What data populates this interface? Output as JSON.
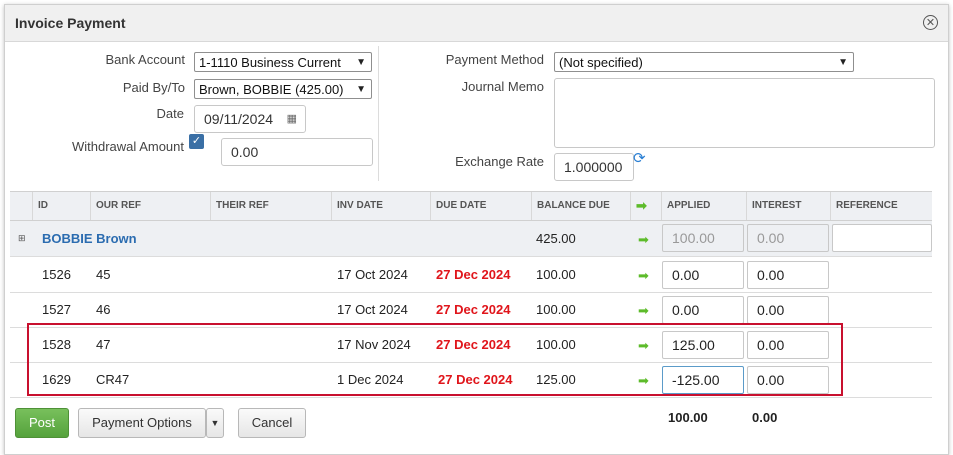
{
  "window": {
    "title": "Invoice Payment"
  },
  "form": {
    "bank_account": {
      "label": "Bank Account",
      "value": "1-1110 Business Current"
    },
    "paid_by": {
      "label": "Paid By/To",
      "value": "Brown, BOBBIE (425.00)"
    },
    "date": {
      "label": "Date",
      "value": "09/11/2024"
    },
    "withdrawal": {
      "label": "Withdrawal Amount",
      "checked": true,
      "value": "0.00"
    },
    "payment_method": {
      "label": "Payment Method",
      "value": "(Not specified)"
    },
    "journal_memo": {
      "label": "Journal Memo",
      "value": ""
    },
    "exchange_rate": {
      "label": "Exchange Rate",
      "value": "1.000000"
    }
  },
  "table": {
    "columns": [
      "ID",
      "OUR REF",
      "THEIR REF",
      "INV DATE",
      "DUE DATE",
      "BALANCE DUE",
      "APPLIED",
      "INTEREST",
      "REFERENCE"
    ],
    "group": {
      "name": "BOBBIE Brown",
      "balance": "425.00",
      "applied": "100.00",
      "interest": "0.00"
    },
    "rows": [
      {
        "id": "1526",
        "our_ref": "45",
        "their_ref": "",
        "inv_date": "17 Oct 2024",
        "due_date": "27 Dec 2024",
        "balance": "100.00",
        "applied": "0.00",
        "interest": "0.00"
      },
      {
        "id": "1527",
        "our_ref": "46",
        "their_ref": "",
        "inv_date": "17 Oct 2024",
        "due_date": "27 Dec 2024",
        "balance": "100.00",
        "applied": "0.00",
        "interest": "0.00"
      },
      {
        "id": "1528",
        "our_ref": "47",
        "their_ref": "",
        "inv_date": "17 Nov 2024",
        "due_date": "27 Dec 2024",
        "balance": "100.00",
        "applied": "125.00",
        "interest": "0.00"
      },
      {
        "id": "1629",
        "our_ref": "CR47",
        "their_ref": "",
        "inv_date": "1 Dec 2024",
        "due_date": "27 Dec 2024",
        "balance": "125.00",
        "applied": "-125.00",
        "interest": "0.00"
      }
    ]
  },
  "totals": {
    "applied": "100.00",
    "interest": "0.00"
  },
  "buttons": {
    "post": "Post",
    "payment_options": "Payment Options",
    "cancel": "Cancel"
  },
  "colors": {
    "due_date": "#e0151b",
    "post_button": "#5fae45",
    "highlight_border": "#c8102e",
    "link": "#2b6cb0"
  },
  "icons": {
    "close": "close-circle-icon",
    "calendar": "calendar-icon",
    "refresh": "refresh-icon",
    "arrow": "green-right-arrow-icon",
    "expand": "expand-icon"
  }
}
